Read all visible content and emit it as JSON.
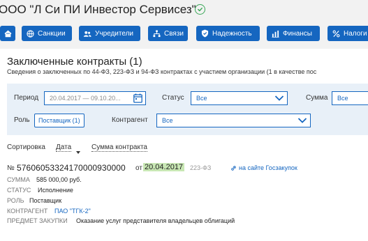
{
  "header": {
    "company_name": "ООО \"Л Си ПИ Инвестор Сервисез\""
  },
  "nav": {
    "home_label": "",
    "sanctions": "Санкции",
    "founders": "Учредители",
    "links": "Связи",
    "reliability": "Надежность",
    "finance": "Финансы",
    "taxes": "Налоги"
  },
  "section": {
    "title": "Заключенные контракты (1)",
    "subtitle": "Сведения о заключенных по 44-ФЗ, 223-ФЗ и 94-ФЗ контрактах с участием организации (1 в качестве пос"
  },
  "filters": {
    "period_label": "Период",
    "period_value": "20.04.2017 — 09.10.20...",
    "status_label": "Статус",
    "status_value": "Все",
    "sum_label": "Сумма",
    "sum_value": "Все",
    "role_label": "Роль",
    "role_value": "Поставщик (1)",
    "counterparty_label": "Контрагент",
    "counterparty_value": "Все"
  },
  "sort": {
    "label": "Сортировка",
    "by_date": "Дата",
    "by_sum": "Сумма контракта"
  },
  "contract": {
    "no_label": "№",
    "number": "5760605332417000093000 0",
    "number_display": "57606053324170000930000",
    "ot": "от",
    "date": "20.04.2017",
    "law": "223-ФЗ",
    "goszakupki_link": "на сайте Госзакупок",
    "sum_label": "СУММА",
    "sum_value": "585 000,00 руб.",
    "status_label": "СТАТУС",
    "status_value": "Исполнение",
    "role_label": "РОЛЬ",
    "role_value": "Поставщик",
    "counterparty_label": "КОНТРАГЕНТ",
    "counterparty_value": "ПАО \"ТГК-2\"",
    "subject_label": "ПРЕДМЕТ ЗАКУПКИ",
    "subject_value": "Оказание услуг представителя владельцев облигаций"
  },
  "colors": {
    "brand": "#1566c0",
    "verified": "#3aa757",
    "date_highlight": "#c8e7b4",
    "filter_bg": "#e8f0f8"
  },
  "icons": {
    "home": "home-icon",
    "sanctions": "globe-icon",
    "founders": "users-icon",
    "links": "network-icon",
    "reliability": "shield-icon",
    "finance": "bar-chart-icon",
    "taxes": "percent-icon",
    "calendar": "calendar-icon",
    "verified": "check-circle-icon",
    "link": "link-icon"
  }
}
